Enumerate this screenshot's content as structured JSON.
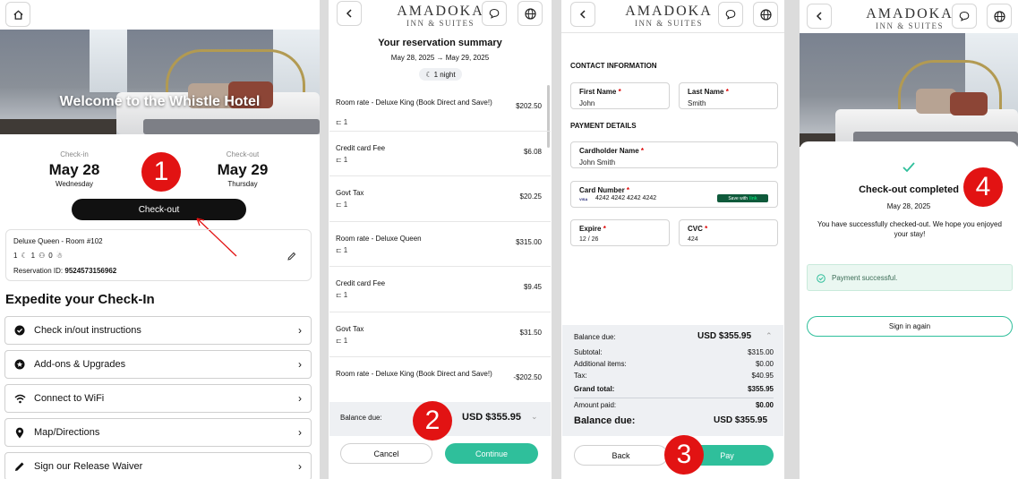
{
  "panel1": {
    "hero_title": "Welcome to the Whistle Hotel",
    "checkin_label": "Check-in",
    "checkin_date": "May 28",
    "checkin_day": "Wednesday",
    "checkout_label": "Check-out",
    "checkout_date": "May 29",
    "checkout_day": "Thursday",
    "checkout_button": "Check-out",
    "room": "Deluxe Queen - Room #102",
    "nights": "1",
    "adults": "1",
    "children": "0",
    "reservation_label": "Reservation ID:",
    "reservation_id": "9524573156962",
    "section_title": "Expedite your Check-In",
    "menu": [
      {
        "label": "Check in/out instructions",
        "icon": "check-circle-icon"
      },
      {
        "label": "Add-ons & Upgrades",
        "icon": "star-icon"
      },
      {
        "label": "Connect to WiFi",
        "icon": "wifi-icon"
      },
      {
        "label": "Map/Directions",
        "icon": "map-pin-icon"
      },
      {
        "label": "Sign our Release Waiver",
        "icon": "pencil-icon"
      }
    ]
  },
  "brand": {
    "name": "AMADOKA",
    "tagline": "INN & SUITES"
  },
  "panel2": {
    "title": "Your reservation summary",
    "dates": "May 28, 2025 → May 29, 2025",
    "nights": "1 night",
    "items": [
      {
        "name": "Room rate - Deluxe King (Book Direct and Save!)",
        "amount": "$202.50",
        "qty": "1"
      },
      {
        "name": "Credit card Fee",
        "amount": "$6.08",
        "qty": "1"
      },
      {
        "name": "Govt Tax",
        "amount": "$20.25",
        "qty": "1"
      },
      {
        "name": "Room rate - Deluxe Queen",
        "amount": "$315.00",
        "qty": "1"
      },
      {
        "name": "Credit card Fee",
        "amount": "$9.45",
        "qty": "1"
      },
      {
        "name": "Govt Tax",
        "amount": "$31.50",
        "qty": "1"
      },
      {
        "name": "Room rate - Deluxe King (Book Direct and Save!)",
        "amount": "-$202.50",
        "qty": ""
      }
    ],
    "balance_label": "Balance due:",
    "balance_value": "USD $355.95",
    "cancel": "Cancel",
    "continue": "Continue"
  },
  "panel3": {
    "contact_heading": "CONTACT INFORMATION",
    "first_name_label": "First Name",
    "first_name": "John",
    "last_name_label": "Last Name",
    "last_name": "Smith",
    "payment_heading": "PAYMENT DETAILS",
    "cardholder_label": "Cardholder Name",
    "cardholder": "John Smith",
    "card_label": "Card Number",
    "card_brand": "VISA",
    "card_number": "4242 4242 4242 4242",
    "link_label": "Save with",
    "link_brand": "link",
    "expire_label": "Expire",
    "expire": "12 / 26",
    "cvc_label": "CVC",
    "cvc": "424",
    "balance_label": "Balance due:",
    "balance_value": "USD $355.95",
    "rows": [
      {
        "label": "Subtotal:",
        "value": "$315.00"
      },
      {
        "label": "Additional items:",
        "value": "$0.00"
      },
      {
        "label": "Tax:",
        "value": "$40.95"
      },
      {
        "label": "Grand total:",
        "value": "$355.95"
      },
      {
        "label": "Amount paid:",
        "value": "$0.00"
      }
    ],
    "final_label": "Balance due:",
    "final_value": "USD $355.95",
    "back": "Back",
    "pay": "Pay"
  },
  "panel4": {
    "title": "Check-out completed",
    "date": "May 28, 2025",
    "message": "You have successfully checked-out. We hope you enjoyed your stay!",
    "payment_status": "Payment successful.",
    "sign_in": "Sign in again"
  },
  "badges": [
    "1",
    "2",
    "3",
    "4"
  ],
  "colors": {
    "accent": "#2fbf9b",
    "badge": "#e21313",
    "dark_button": "#111111"
  }
}
